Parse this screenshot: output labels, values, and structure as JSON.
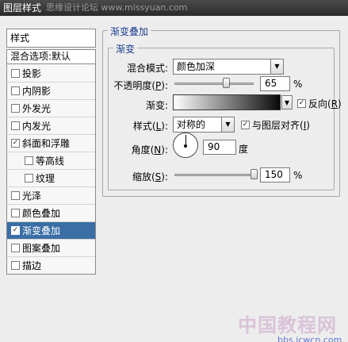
{
  "window": {
    "title": "图层样式"
  },
  "watermark_top": "思缘设计论坛 www.missyuan.com",
  "left_panel": {
    "header": "样式",
    "blend_options": "混合选项:默认",
    "items": [
      {
        "label": "投影",
        "checked": false,
        "indent": false,
        "selected": false
      },
      {
        "label": "内阴影",
        "checked": false,
        "indent": false,
        "selected": false
      },
      {
        "label": "外发光",
        "checked": false,
        "indent": false,
        "selected": false
      },
      {
        "label": "内发光",
        "checked": false,
        "indent": false,
        "selected": false
      },
      {
        "label": "斜面和浮雕",
        "checked": true,
        "indent": false,
        "selected": false
      },
      {
        "label": "等高线",
        "checked": false,
        "indent": true,
        "selected": false
      },
      {
        "label": "纹理",
        "checked": false,
        "indent": true,
        "selected": false
      },
      {
        "label": "光泽",
        "checked": false,
        "indent": false,
        "selected": false
      },
      {
        "label": "颜色叠加",
        "checked": false,
        "indent": false,
        "selected": false
      },
      {
        "label": "渐变叠加",
        "checked": true,
        "indent": false,
        "selected": true
      },
      {
        "label": "图案叠加",
        "checked": false,
        "indent": false,
        "selected": false
      },
      {
        "label": "描边",
        "checked": false,
        "indent": false,
        "selected": false
      }
    ]
  },
  "gradient_overlay": {
    "outer_title": "渐变叠加",
    "inner_title": "渐变",
    "blend_mode_label": "混合模式:",
    "blend_mode_value": "颜色加深",
    "opacity_label_pre": "不透明度(",
    "opacity_key": "P",
    "opacity_label_post": "):",
    "opacity_value": "65",
    "opacity_percent": 65,
    "percent_unit": "%",
    "gradient_label": "渐变:",
    "reverse_label": "反向(",
    "reverse_key": "R",
    "reverse_post": ")",
    "reverse_checked": true,
    "style_label_pre": "样式(",
    "style_key": "L",
    "style_label_post": "):",
    "style_value": "对称的",
    "align_label": "与图层对齐(",
    "align_key": "I",
    "align_post": ")",
    "align_checked": true,
    "angle_label_pre": "角度(",
    "angle_key": "N",
    "angle_label_post": "):",
    "angle_value": "90",
    "angle_unit": "度",
    "scale_label_pre": "缩放(",
    "scale_key": "S",
    "scale_label_post": "):",
    "scale_value": "150",
    "scale_percent": 150,
    "gradient_colors": [
      "#ffffff",
      "#0a0a0a"
    ],
    "check_mark": "✓",
    "dropdown_arrow": "▼"
  },
  "watermark_bottom": {
    "text": "中国教程网",
    "url": "bbs.jcwcn.com"
  },
  "colors": {
    "selected_bg": "#3a6ea5",
    "legend_text": "#1b3c8e"
  }
}
